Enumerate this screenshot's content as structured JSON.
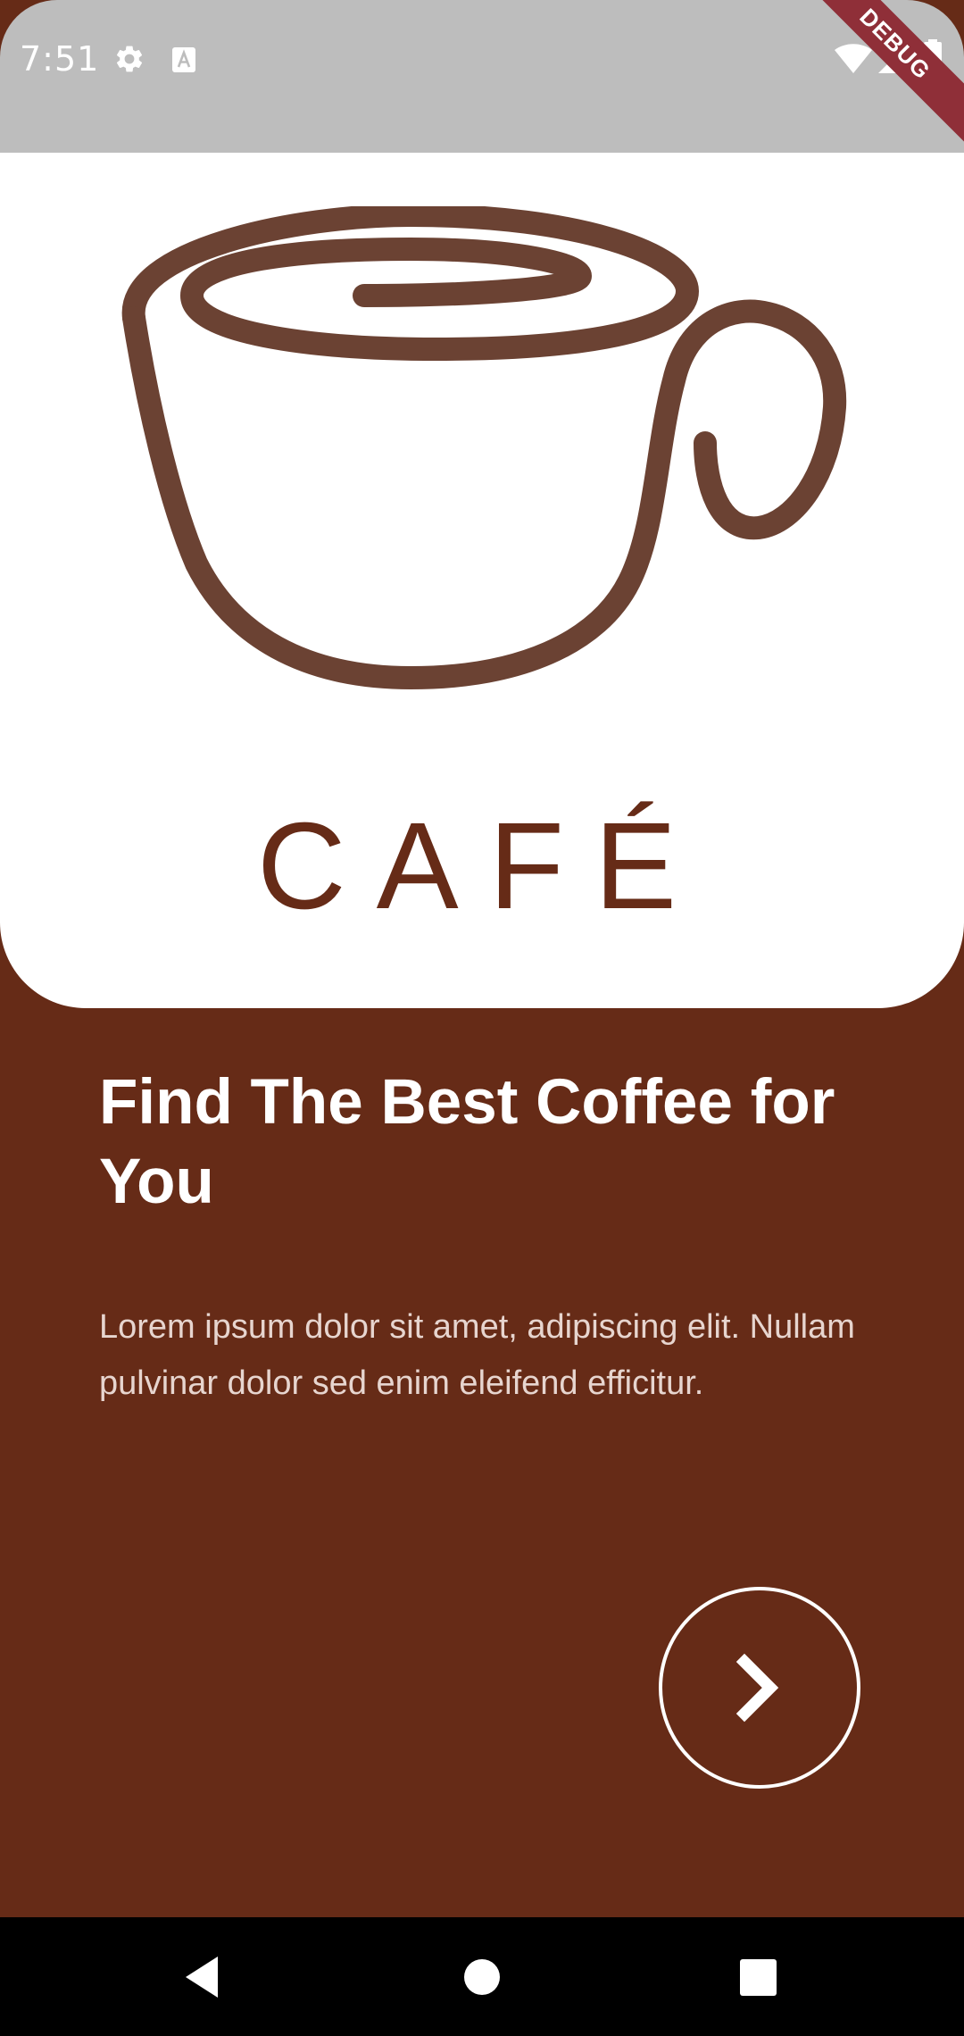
{
  "status_bar": {
    "time": "7:51",
    "left_icons": [
      "gear-icon",
      "text-a-icon"
    ],
    "right_icons": [
      "wifi-icon",
      "cell-signal-icon",
      "battery-icon"
    ]
  },
  "debug_banner": "DEBUG",
  "hero": {
    "logo_icon": "coffee-cup-icon",
    "brand": "CAFÉ"
  },
  "content": {
    "headline": "Find The Best Coffee for You",
    "description": "Lorem ipsum dolor sit amet, adipiscing elit. Nullam pulvinar dolor sed enim eleifend efficitur."
  },
  "next_button": {
    "icon": "chevron-right-icon"
  },
  "navigation_bar": {
    "buttons": [
      "back-icon",
      "home-icon",
      "recents-icon"
    ]
  },
  "colors": {
    "background": "#662B17",
    "card": "#FFFFFF",
    "logo": "#6B4233",
    "status_bar": "#BDBDBD",
    "debug_banner": "#8F2F38",
    "text_primary": "#FFFFFF"
  }
}
